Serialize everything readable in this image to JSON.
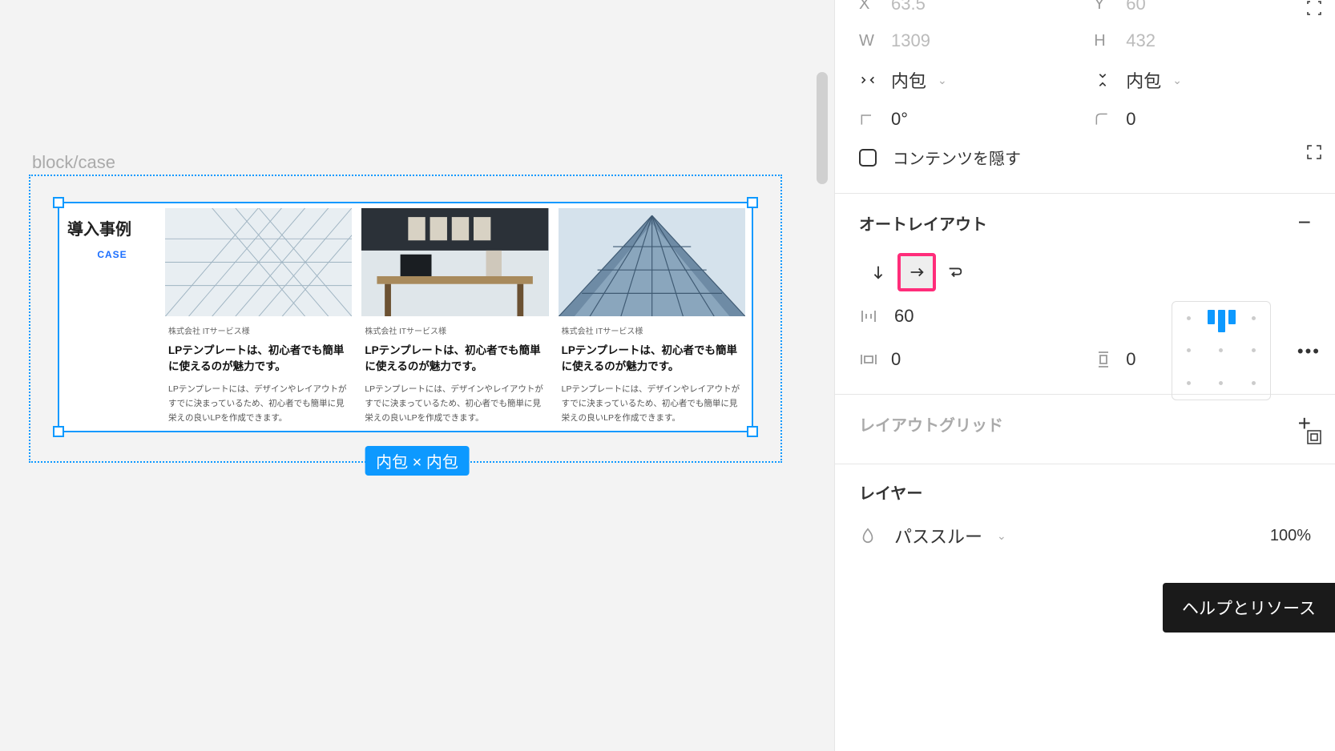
{
  "canvas": {
    "frame_label": "block/case",
    "size_badge": "内包 × 内包"
  },
  "case": {
    "title": "導入事例",
    "subtitle": "CASE",
    "cards": [
      {
        "company": "株式会社 ITサービス様",
        "heading": "LPテンプレートは、初心者でも簡単に使えるのが魅力です。",
        "desc": "LPテンプレートには、デザインやレイアウトがすでに決まっているため、初心者でも簡単に見栄えの良いLPを作成できます。"
      },
      {
        "company": "株式会社 ITサービス様",
        "heading": "LPテンプレートは、初心者でも簡単に使えるのが魅力です。",
        "desc": "LPテンプレートには、デザインやレイアウトがすでに決まっているため、初心者でも簡単に見栄えの良いLPを作成できます。"
      },
      {
        "company": "株式会社 ITサービス様",
        "heading": "LPテンプレートは、初心者でも簡単に使えるのが魅力です。",
        "desc": "LPテンプレートには、デザインやレイアウトがすでに決まっているため、初心者でも簡単に見栄えの良いLPを作成できます。"
      }
    ]
  },
  "panel": {
    "x": {
      "label": "X",
      "value": "63.5"
    },
    "y": {
      "label": "Y",
      "value": "60"
    },
    "w": {
      "label": "W",
      "value": "1309"
    },
    "h": {
      "label": "H",
      "value": "432"
    },
    "h_resize": "内包",
    "v_resize": "内包",
    "rotation": "0°",
    "corner": "0",
    "clip_label": "コンテンツを隠す",
    "autolayout": {
      "title": "オートレイアウト",
      "gap": "60",
      "pad_h": "0",
      "pad_v": "0"
    },
    "layout_grid_title": "レイアウトグリッド",
    "layer": {
      "title": "レイヤー",
      "blend": "パススルー",
      "opacity": "100%"
    },
    "tooltip": "ヘルプとリソース"
  }
}
